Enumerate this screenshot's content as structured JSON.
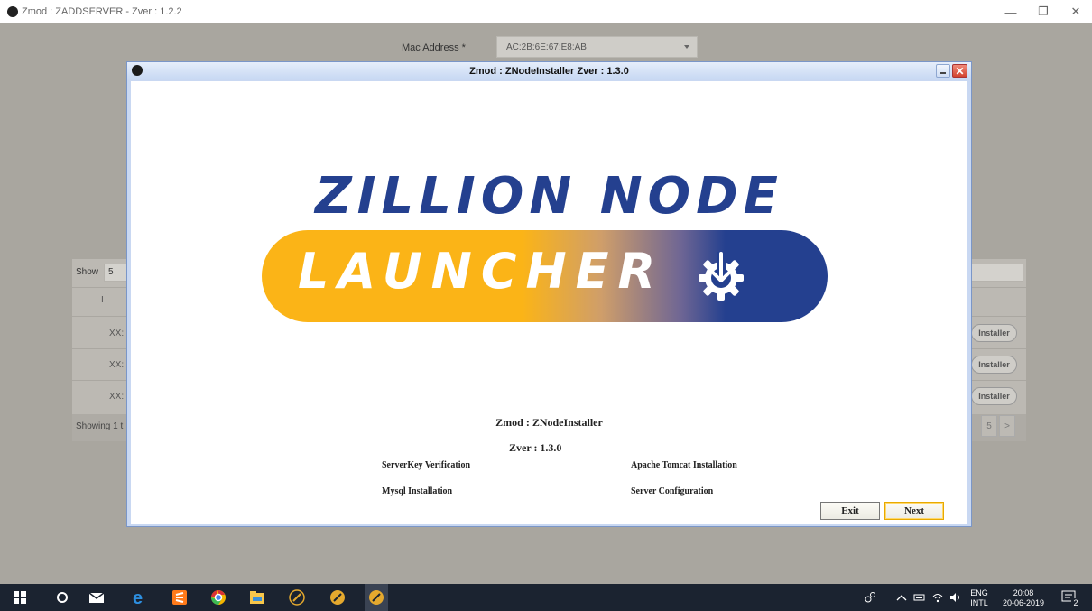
{
  "main_window": {
    "title": "Zmod : ZADDSERVER - Zver : 1.2.2",
    "minimize": "—",
    "restore": "❐",
    "close": "✕"
  },
  "background_form": {
    "mac_label": "Mac Address *",
    "mac_value": "AC:2B:6E:67:E8:AB",
    "show_label": "Show",
    "show_value": "5",
    "col_header_partial": "I",
    "rows": [
      {
        "cell": "XX:",
        "button": "Installer"
      },
      {
        "cell": "XX:",
        "button": "Installer"
      },
      {
        "cell": "XX:",
        "button": "Installer"
      }
    ],
    "showing_text": "Showing 1 t",
    "pages": [
      "5",
      ">"
    ]
  },
  "dialog": {
    "title": "Zmod : ZNodeInstaller Zver : 1.3.0",
    "logo_line1": "ZILLION NODE",
    "logo_line2": "LAUNCHER",
    "info_title": "Zmod : ZNodeInstaller",
    "info_version": "Zver  : 1.3.0",
    "steps": {
      "serverkey": "ServerKey Verification",
      "tomcat": "Apache Tomcat Installation",
      "mysql": "Mysql Installation",
      "server_config": "Server Configuration"
    },
    "exit_label": "Exit",
    "next_label": "Next"
  },
  "taskbar": {
    "icons": [
      "windows-start-icon",
      "cortana-search-icon",
      "mail-icon",
      "edge-icon",
      "sublime-icon",
      "chrome-icon",
      "file-explorer-icon",
      "zmod-app-icon",
      "zmod-app-icon",
      "zmod-app-icon"
    ],
    "language": "ENG",
    "keyboard": "INTL",
    "time": "20:08",
    "date": "20-06-2019",
    "notifications": "2"
  },
  "colors": {
    "logo_blue": "#24408f",
    "logo_yellow": "#fbb417",
    "next_border": "#e8a900"
  }
}
